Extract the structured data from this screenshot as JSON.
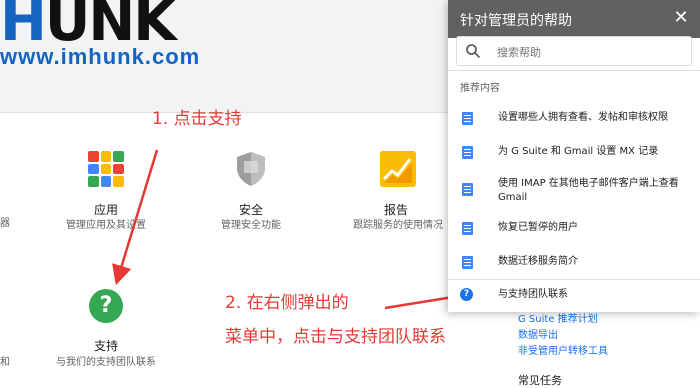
{
  "watermark": {
    "logo": "HUNK",
    "site": "www.imhunk.com"
  },
  "tiles": {
    "left_cut_1": "器",
    "left_cut_2": "和",
    "apps": {
      "title": "应用",
      "desc": "管理应用及其设置"
    },
    "security": {
      "title": "安全",
      "desc": "管理安全功能"
    },
    "reports": {
      "title": "报告",
      "desc": "跟踪服务的使用情况"
    },
    "support": {
      "title": "支持",
      "desc": "与我们的支持团队联系"
    }
  },
  "annotations": {
    "step1": "1. 点击支持",
    "step2_line1": "2. 在右侧弹出的",
    "step2_line2": "菜单中，点击与支持团队联系"
  },
  "help_panel": {
    "title": "针对管理员的帮助",
    "close": "✕",
    "search_placeholder": "搜索帮助",
    "section": "推荐内容",
    "items": [
      "设置哪些人拥有查看、发帖和审核权限",
      "为 G Suite 和 Gmail 设置 MX 记录",
      "使用 IMAP 在其他电子邮件客户端上查看 Gmail",
      "恢复已暂停的用户",
      "数据迁移服务简介"
    ],
    "contact": "与支持团队联系"
  },
  "background_links": [
    "G Suite 推荐计划",
    "数据导出",
    "非受管用户转移工具"
  ],
  "common_tasks": "常见任务",
  "colors": {
    "annotation": "#e53935",
    "panel_header": "#616161",
    "link": "#1a73e8"
  }
}
